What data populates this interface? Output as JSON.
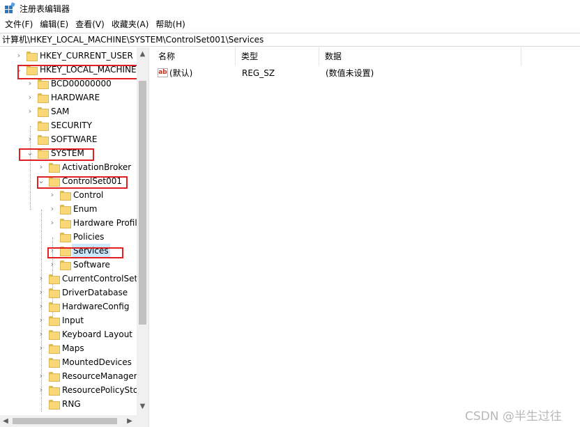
{
  "window": {
    "title": "注册表编辑器",
    "icon": "regedit-icon"
  },
  "menu": [
    "文件(F)",
    "编辑(E)",
    "查看(V)",
    "收藏夹(A)",
    "帮助(H)"
  ],
  "address": "计算机\\HKEY_LOCAL_MACHINE\\SYSTEM\\ControlSet001\\Services",
  "tree": [
    {
      "label": "HKEY_CURRENT_USER",
      "arrow": "›"
    },
    {
      "label": "HKEY_LOCAL_MACHINE",
      "arrow": "⌄"
    },
    {
      "label": "BCD00000000",
      "arrow": "›"
    },
    {
      "label": "HARDWARE",
      "arrow": "›"
    },
    {
      "label": "SAM",
      "arrow": "›"
    },
    {
      "label": "SECURITY",
      "arrow": ""
    },
    {
      "label": "SOFTWARE",
      "arrow": "›"
    },
    {
      "label": "SYSTEM",
      "arrow": "⌄"
    },
    {
      "label": "ActivationBroker",
      "arrow": "›"
    },
    {
      "label": "ControlSet001",
      "arrow": "⌄"
    },
    {
      "label": "Control",
      "arrow": "›"
    },
    {
      "label": "Enum",
      "arrow": "›"
    },
    {
      "label": "Hardware Profil",
      "arrow": "›"
    },
    {
      "label": "Policies",
      "arrow": ""
    },
    {
      "label": "Services",
      "arrow": "›"
    },
    {
      "label": "Software",
      "arrow": "›"
    },
    {
      "label": "CurrentControlSet",
      "arrow": "›"
    },
    {
      "label": "DriverDatabase",
      "arrow": "›"
    },
    {
      "label": "HardwareConfig",
      "arrow": "›"
    },
    {
      "label": "Input",
      "arrow": "›"
    },
    {
      "label": "Keyboard Layout",
      "arrow": "›"
    },
    {
      "label": "Maps",
      "arrow": "›"
    },
    {
      "label": "MountedDevices",
      "arrow": ""
    },
    {
      "label": "ResourceManager",
      "arrow": "›"
    },
    {
      "label": "ResourcePolicySto",
      "arrow": "›"
    },
    {
      "label": "RNG",
      "arrow": ""
    }
  ],
  "columns": {
    "name": "名称",
    "type": "类型",
    "data": "数据"
  },
  "values": [
    {
      "name": "(默认)",
      "type": "REG_SZ",
      "data": "(数值未设置)",
      "icon": "ab"
    }
  ],
  "scroll": {
    "up": "▲",
    "down": "▼",
    "left": "◀",
    "right": "▶"
  },
  "watermark": "CSDN @半生过往",
  "colors": {
    "highlight": "#e02020",
    "selection": "#cce8ff",
    "folder": "#f6d77a"
  }
}
